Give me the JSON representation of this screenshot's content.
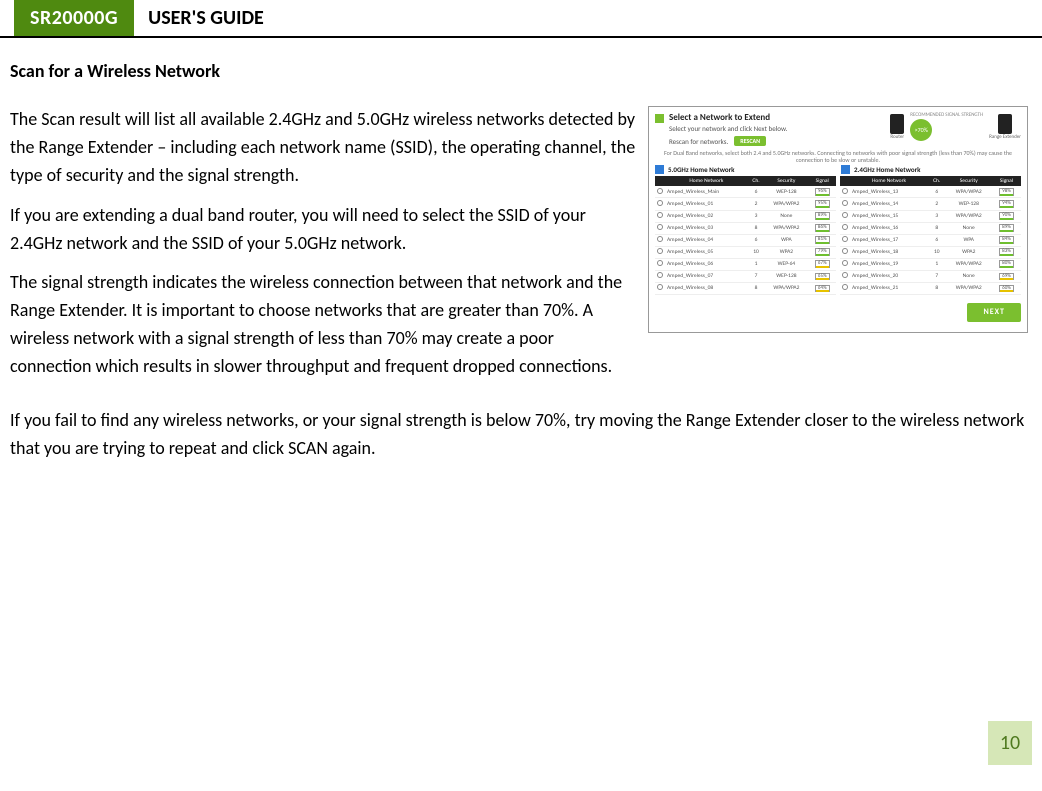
{
  "header": {
    "model": "SR20000G",
    "title": "USER'S GUIDE"
  },
  "section_title": "Scan for a Wireless Network",
  "paragraphs": {
    "p1": "The Scan result will list all available 2.4GHz and 5.0GHz wireless networks detected by the Range Extender – including each network name (SSID), the operating channel, the type of security and the signal strength.",
    "p2": "If you are extending a dual band router, you will need to select the SSID of your 2.4GHz network and the SSID of your 5.0GHz network.",
    "p3": "The signal strength indicates the wireless connection between that network and the Range Extender. It is important to choose networks that are greater than 70%. A wireless network with a signal strength of less than 70% may create a poor connection which results in slower throughput and frequent dropped connections.",
    "p4": "If you fail to find any wireless networks, or your signal strength is below 70%, try moving the Range Extender closer to the wireless network that you are trying to repeat and click SCAN again."
  },
  "screenshot": {
    "title": "Select a Network to Extend",
    "sub1": "Select your network and click Next below.",
    "sub2": "Rescan for networks.",
    "rescan": "RESCAN",
    "rec_label": "RECOMMENDED SIGNAL STRENGTH",
    "badge": ">70%",
    "router_label": "Router",
    "extender_label": "Range Extender",
    "note": "For Dual Band networks, select both 2.4 and 5.0GHz networks. Connecting to networks with poor signal strength (less than 70%) may cause the connection to be slow or unstable.",
    "band5": "5.0GHz Home Network",
    "band24": "2.4GHz Home Network",
    "columns": {
      "c1": "Home Network",
      "c2": "Ch.",
      "c3": "Security",
      "c4": "Signal"
    },
    "next": "NEXT",
    "net5": [
      {
        "name": "Amped_Wireless_Main",
        "ch": "6",
        "sec": "WEP-128",
        "sig": "96%",
        "cls": "sig-g"
      },
      {
        "name": "Amped_Wireless_01",
        "ch": "2",
        "sec": "WPA/WPA2",
        "sig": "95%",
        "cls": "sig-g"
      },
      {
        "name": "Amped_Wireless_02",
        "ch": "3",
        "sec": "None",
        "sig": "89%",
        "cls": "sig-g"
      },
      {
        "name": "Amped_Wireless_03",
        "ch": "8",
        "sec": "WPA/WPA2",
        "sig": "86%",
        "cls": "sig-g"
      },
      {
        "name": "Amped_Wireless_04",
        "ch": "6",
        "sec": "WPA",
        "sig": "81%",
        "cls": "sig-g"
      },
      {
        "name": "Amped_Wireless_05",
        "ch": "10",
        "sec": "WPA2",
        "sig": "79%",
        "cls": "sig-g"
      },
      {
        "name": "Amped_Wireless_06",
        "ch": "1",
        "sec": "WEP-64",
        "sig": "67%",
        "cls": "sig-y"
      },
      {
        "name": "Amped_Wireless_07",
        "ch": "7",
        "sec": "WEP-128",
        "sig": "65%",
        "cls": "sig-y"
      },
      {
        "name": "Amped_Wireless_08",
        "ch": "8",
        "sec": "WPA/WPA2",
        "sig": "64%",
        "cls": "sig-y"
      }
    ],
    "net24": [
      {
        "name": "Amped_Wireless_13",
        "ch": "6",
        "sec": "WPA/WPA2",
        "sig": "98%",
        "cls": "sig-g"
      },
      {
        "name": "Amped_Wireless_14",
        "ch": "2",
        "sec": "WEP-128",
        "sig": "94%",
        "cls": "sig-g"
      },
      {
        "name": "Amped_Wireless_15",
        "ch": "3",
        "sec": "WPA/WPA2",
        "sig": "90%",
        "cls": "sig-g"
      },
      {
        "name": "Amped_Wireless_16",
        "ch": "8",
        "sec": "None",
        "sig": "89%",
        "cls": "sig-g"
      },
      {
        "name": "Amped_Wireless_17",
        "ch": "6",
        "sec": "WPA",
        "sig": "84%",
        "cls": "sig-g"
      },
      {
        "name": "Amped_Wireless_18",
        "ch": "10",
        "sec": "WPA2",
        "sig": "83%",
        "cls": "sig-g"
      },
      {
        "name": "Amped_Wireless_19",
        "ch": "1",
        "sec": "WPA/WPA2",
        "sig": "80%",
        "cls": "sig-g"
      },
      {
        "name": "Amped_Wireless_20",
        "ch": "7",
        "sec": "None",
        "sig": "69%",
        "cls": "sig-y"
      },
      {
        "name": "Amped_Wireless_21",
        "ch": "8",
        "sec": "WPA/WPA2",
        "sig": "60%",
        "cls": "sig-y"
      }
    ]
  },
  "page_number": "10"
}
